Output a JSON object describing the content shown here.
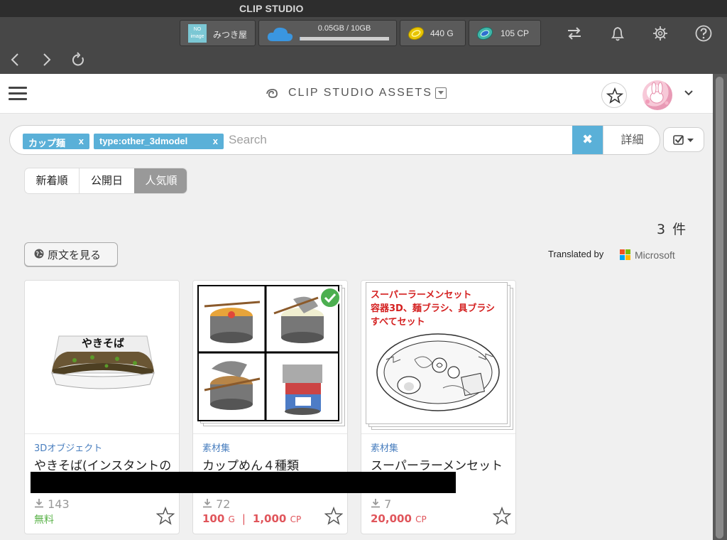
{
  "app": {
    "title": "CLIP STUDIO"
  },
  "toolbar": {
    "user_name": "みつき屋",
    "user_avatar_text": "NO image",
    "storage_text": "0.05GB / 10GB",
    "storage_fill": 0.005,
    "gold": "440 G",
    "cp": "105 CP",
    "icons": [
      "sync-icon",
      "bell-icon",
      "gear-icon",
      "help-icon"
    ]
  },
  "nav": {
    "icons": [
      "back-icon",
      "forward-icon",
      "reload-icon"
    ]
  },
  "header": {
    "brand": "CLIP STUDIO ASSETS"
  },
  "search": {
    "tags": [
      {
        "label": "カップ麺",
        "remove": "x"
      },
      {
        "label": "type:other_3dmodel",
        "remove": "x"
      }
    ],
    "placeholder": "Search",
    "clear": "✖",
    "detail": "詳細"
  },
  "sort": {
    "tabs": [
      "新着順",
      "公開日",
      "人気順"
    ],
    "active": 2
  },
  "results": {
    "count": "3 件",
    "original_button": "原文を見る",
    "translated_by": "Translated by",
    "translator": "Microsoft"
  },
  "cards": [
    {
      "category": "3Dオブジェクト",
      "name": "やきそば(インスタントの",
      "downloads": "143",
      "price": "無料",
      "thumb_text": "やきそば"
    },
    {
      "category": "素材集",
      "name": "カップめん４種類",
      "downloads": "72",
      "price_gold": "100",
      "price_gold_unit": "G",
      "price_cp": "1,000",
      "price_cp_unit": "CP"
    },
    {
      "category": "素材集",
      "name": "スーパーラーメンセット",
      "downloads": "7",
      "price_cp": "20,000",
      "price_cp_unit": "CP",
      "thumb_lines": [
        "スーパーラーメンセット",
        "容器3D、麺ブラシ、具ブラシ",
        "すべてセット"
      ]
    }
  ],
  "colors": {
    "accent": "#5ab0d8",
    "price": "#e0555b",
    "free": "#5bb34a",
    "category": "#4a7fbf"
  }
}
